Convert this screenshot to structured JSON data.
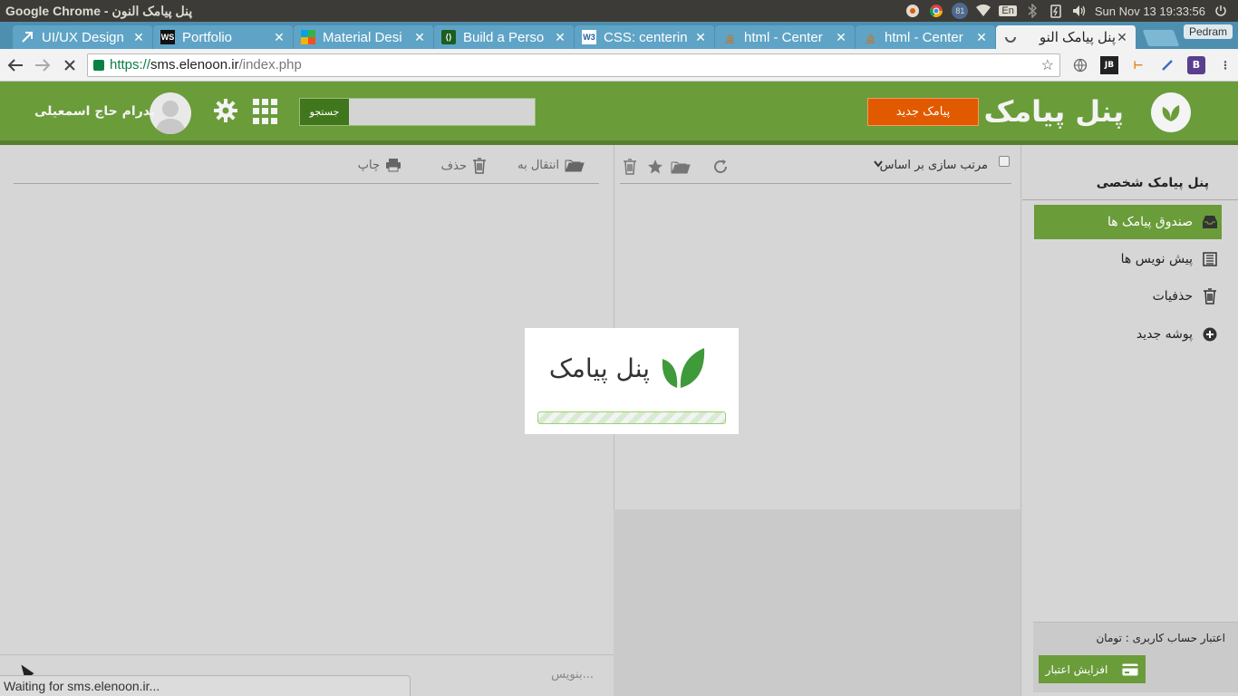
{
  "os": {
    "window_title": "Google Chrome - پنل پیامک النون",
    "battery_badge": "81",
    "keyboard": "En",
    "clock": "Sun Nov 13 19:33:56"
  },
  "browser": {
    "tabs": [
      {
        "label": "UI/UX Design",
        "icon": "arrow-icon"
      },
      {
        "label": "Portfolio",
        "icon": "ws-icon"
      },
      {
        "label": "Material Desi",
        "icon": "ms-icon"
      },
      {
        "label": "Build a Perso",
        "icon": "code-icon"
      },
      {
        "label": "CSS: centerin",
        "icon": "w3-icon"
      },
      {
        "label": "html - Center",
        "icon": "so-icon"
      },
      {
        "label": "html - Center",
        "icon": "so-icon"
      },
      {
        "label": "پنل پیامک النو",
        "icon": "loading-icon"
      }
    ],
    "profile": "Pedram",
    "url_scheme": "https://",
    "url_host": "sms.elenoon.ir",
    "url_path": "/index.php",
    "status_text": "Waiting for sms.elenoon.ir..."
  },
  "header": {
    "brand": "پنل پیامک",
    "new_sms": "پیامک جدید",
    "search_button": "جستجو",
    "user_name": "پدرام حاج اسمعیلی",
    "accent": "#6a9c3a"
  },
  "sidebar": {
    "title": "پنل پیامک شخصی",
    "items": [
      {
        "label": "صندوق پیامک ها",
        "icon": "inbox-icon"
      },
      {
        "label": "پیش نویس ها",
        "icon": "drafts-icon"
      },
      {
        "label": "حذفیات",
        "icon": "trash-icon"
      },
      {
        "label": "پوشه جدید",
        "icon": "plus-circle-icon"
      }
    ],
    "credit_label": "اعتبار حساب کاربری :  تومان",
    "credit_button": "افزایش اعتبار"
  },
  "list": {
    "sort_label": "مرتب سازی بر اساس"
  },
  "detail": {
    "move_to": "انتقال به",
    "delete": "حذف",
    "print": "چاپ",
    "compose_placeholder": "بنویس..."
  },
  "loader": {
    "title": "پنل پیامک"
  }
}
